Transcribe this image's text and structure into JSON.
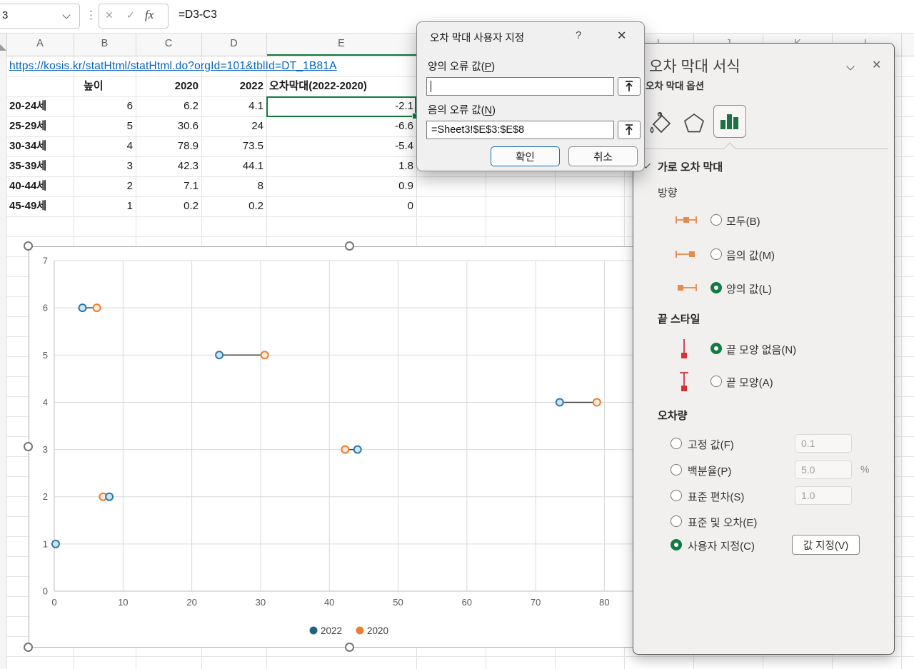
{
  "app": {
    "name_box": "3",
    "formula": "=D3-C3",
    "fx": "fx",
    "cancel_glyph": "✕",
    "enter_glyph": "✓",
    "dots_glyph": "⋮"
  },
  "sheet": {
    "columns": [
      "A",
      "B",
      "C",
      "D",
      "E"
    ],
    "far_columns": [
      "I",
      "J",
      "K",
      "L"
    ],
    "url": "https://kosis.kr/statHtml/statHtml.do?orgId=101&tblId=DT_1B81A",
    "headers": {
      "b": "높이",
      "c": "2020",
      "d": "2022",
      "e": "오차막대(2022-2020)"
    },
    "rows": [
      {
        "label": "20-24세",
        "b": "6",
        "c": "6.2",
        "d": "4.1",
        "e": "-2.1"
      },
      {
        "label": "25-29세",
        "b": "5",
        "c": "30.6",
        "d": "24",
        "e": "-6.6"
      },
      {
        "label": "30-34세",
        "b": "4",
        "c": "78.9",
        "d": "73.5",
        "e": "-5.4"
      },
      {
        "label": "35-39세",
        "b": "3",
        "c": "42.3",
        "d": "44.1",
        "e": "1.8"
      },
      {
        "label": "40-44세",
        "b": "2",
        "c": "7.1",
        "d": "8",
        "e": "0.9"
      },
      {
        "label": "45-49세",
        "b": "1",
        "c": "0.2",
        "d": "0.2",
        "e": "0"
      }
    ]
  },
  "chart_data": {
    "type": "scatter",
    "title": "",
    "xlabel": "",
    "ylabel": "",
    "xlim": [
      0,
      90
    ],
    "ylim": [
      0,
      7
    ],
    "x_ticks": [
      0,
      10,
      20,
      30,
      40,
      50,
      60,
      70,
      80
    ],
    "y_ticks": [
      0,
      1,
      2,
      3,
      4,
      5,
      6,
      7
    ],
    "grid": true,
    "legend_position": "bottom",
    "error_bar_color": "#3f3f3f",
    "series": [
      {
        "name": "2022",
        "legend_color": "#1F6387",
        "marker_stroke": "#2E79AC",
        "marker_fill": "#CDE4F5",
        "points": [
          {
            "x": 4.1,
            "y": 6
          },
          {
            "x": 24,
            "y": 5
          },
          {
            "x": 73.5,
            "y": 4
          },
          {
            "x": 44.1,
            "y": 3
          },
          {
            "x": 8,
            "y": 2
          },
          {
            "x": 0.2,
            "y": 1
          }
        ]
      },
      {
        "name": "2020",
        "legend_color": "#ED7D31",
        "marker_stroke": "#ED7D31",
        "marker_fill": "#FBEBDC",
        "points": [
          {
            "x": 6.2,
            "y": 6
          },
          {
            "x": 30.6,
            "y": 5
          },
          {
            "x": 78.9,
            "y": 4
          },
          {
            "x": 42.3,
            "y": 3
          },
          {
            "x": 7.1,
            "y": 2
          },
          {
            "x": 0.2,
            "y": 1
          }
        ]
      }
    ],
    "error_bars_between_series": true
  },
  "dialog": {
    "title": "오차 막대 사용자 지정",
    "help": "?",
    "close": "✕",
    "pos_pre": "양의 오류 값(",
    "pos_key": "P",
    "pos_post": ")",
    "neg_pre": "음의 오류 값(",
    "neg_key": "N",
    "neg_post": ")",
    "pos_value": "",
    "neg_value": "=Sheet3!$E$3:$E$8",
    "ok": "확인",
    "cancel": "취소"
  },
  "panel": {
    "title": "오차 막대 서식",
    "close": "✕",
    "tab": "오차 막대 옵션",
    "section": "가로 오차 막대",
    "direction_label": "방향",
    "dir_all": "모두(B)",
    "dir_minus": "음의 값(M)",
    "dir_plus": "양의 값(L)",
    "end_style_label": "끝 스타일",
    "end_none": "끝 모양 없음(N)",
    "end_cap": "끝 모양(A)",
    "amount_label": "오차량",
    "fixed": "고정 값(F)",
    "fixed_value": "0.1",
    "pct": "백분율(P)",
    "pct_value": "5.0",
    "pct_suffix": "%",
    "std": "표준 편차(S)",
    "std_value": "1.0",
    "stderr": "표준 및 오차(E)",
    "custom": "사용자 지정(C)",
    "specify_btn": "값 지정(V)"
  },
  "colors": {
    "selection_green": "#107C41",
    "link_blue": "#0563C1",
    "ok_accent_blue": "#0F6CBD",
    "direction_icon_orange": "#E8884A",
    "end_style_icon_red": "#D13438",
    "bars_icon_green": "#1E7145"
  }
}
